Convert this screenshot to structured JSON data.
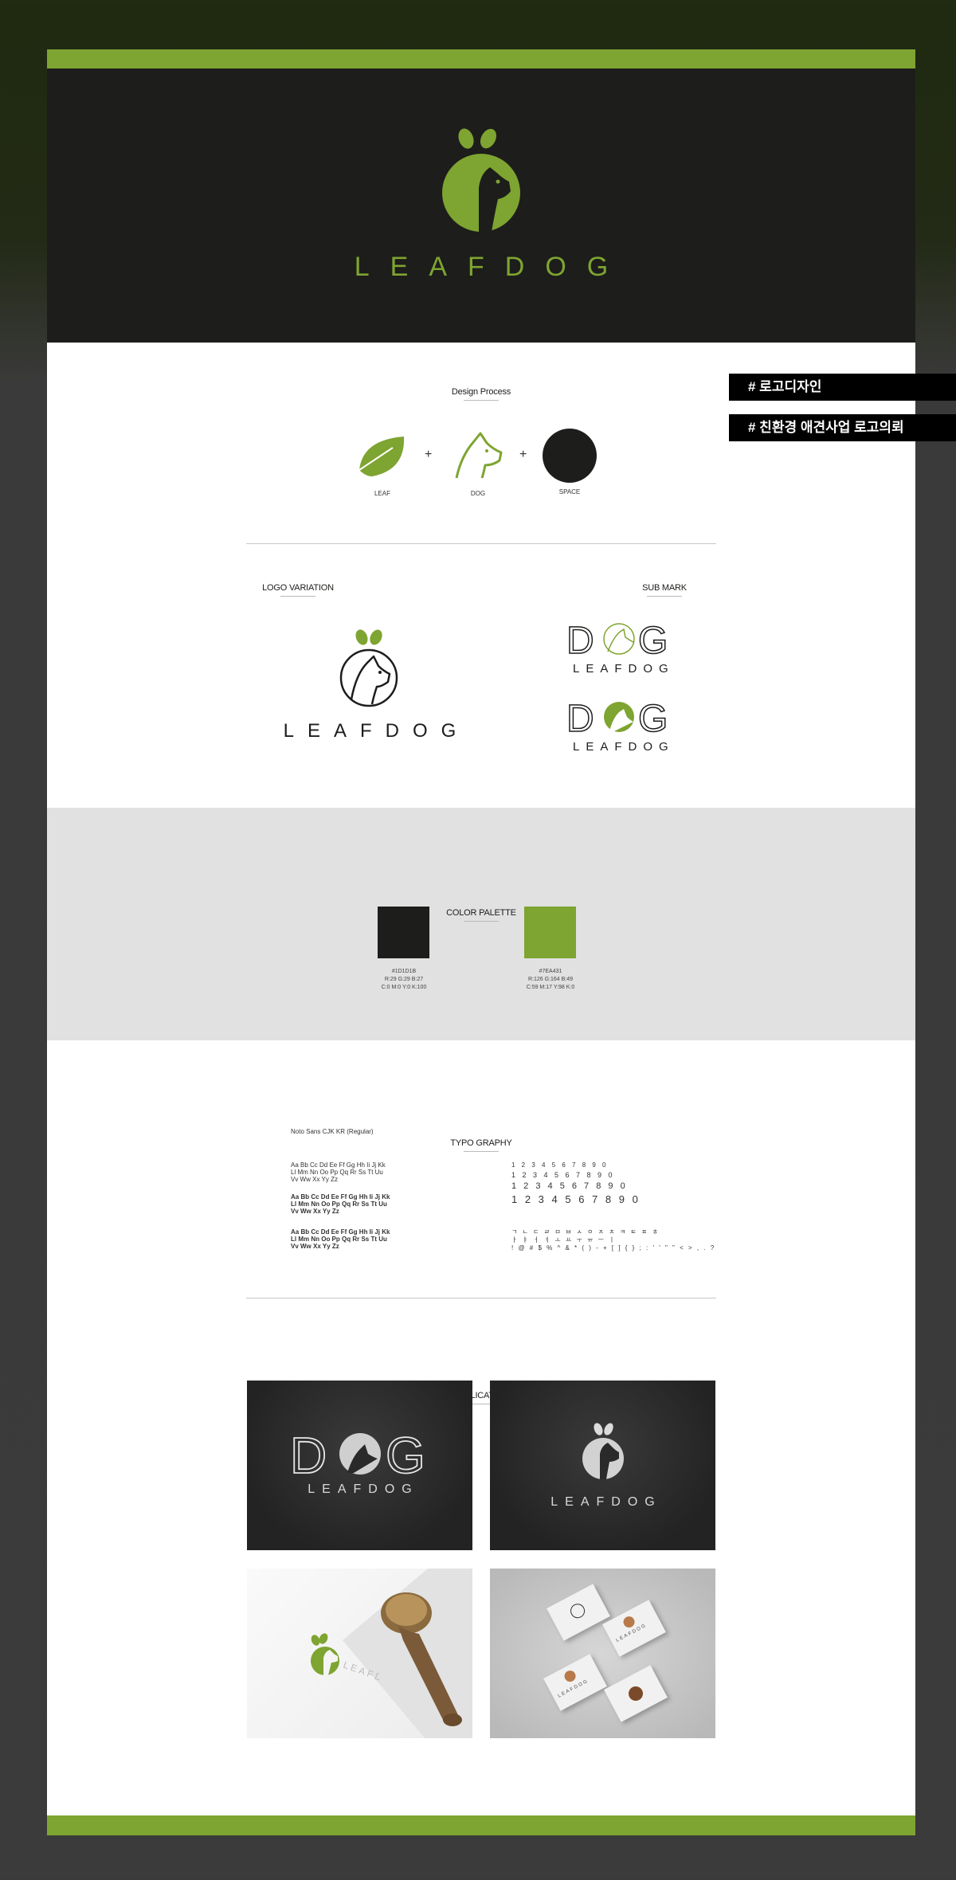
{
  "brand": {
    "name": "LEAFDOG",
    "colors": {
      "green": "#7ea431",
      "black": "#1d1d1b"
    }
  },
  "tags": [
    "# 로고디자인",
    "# 친환경 애견사업 로고의뢰"
  ],
  "design_process": {
    "title": "Design Process",
    "items": [
      {
        "label": "LEAF",
        "icon": "leaf-icon"
      },
      {
        "label": "DOG",
        "icon": "dog-outline-icon"
      },
      {
        "label": "SPACE",
        "icon": "circle-icon"
      }
    ],
    "operator": "+"
  },
  "logo_variation": {
    "title": "LOGO VARIATION",
    "wordmark": "LEAFDOG"
  },
  "sub_mark": {
    "title": "SUB MARK",
    "mark": "DOG",
    "wordmark": "LEAFDOG"
  },
  "color_palette": {
    "title": "COLOR PALETTE",
    "swatches": [
      {
        "hex_label": "#1D1D1B",
        "hex": "#1d1d1b",
        "rgb": "R:29   G:29   B:27",
        "cmyk": "C:0   M:0   Y:0   K:100"
      },
      {
        "hex_label": "#7EA431",
        "hex": "#7ea431",
        "rgb": "R:126   G:164   B:49",
        "cmyk": "C:59   M:17   Y:98   K:0"
      }
    ]
  },
  "typography": {
    "title": "TYPO GRAPHY",
    "font": "Noto Sans CJK KR (Regular)",
    "alphabet_lines": [
      "Aa Bb Cc Dd Ee Ff Gg Hh Ii Jj Kk",
      "Ll Mm Nn Oo Pp Qq Rr Ss Tt Uu",
      "Vv Ww Xx Yy Zz"
    ],
    "numbers": "1 2 3 4 5 6 7 8 9 0",
    "hangul_consonants": "ㄱ ㄴ ㄷ ㄹ ㅁ ㅂ ㅅ ㅇ ㅈ ㅊ ㅋ ㅌ ㅍ ㅎ",
    "hangul_vowels": "ㅏ ㅑ ㅓ ㅕ ㅗ ㅛ ㅜ ㅠ ㅡ ㅣ",
    "symbols": "! @ # $ % ^ & * ( ) - + [ ] { } ; : ' ' \" \" < > , . ?"
  },
  "application": {
    "title": "APPLICATION",
    "sign_mark": "DOG",
    "wordmark": "LEAFDOG"
  }
}
